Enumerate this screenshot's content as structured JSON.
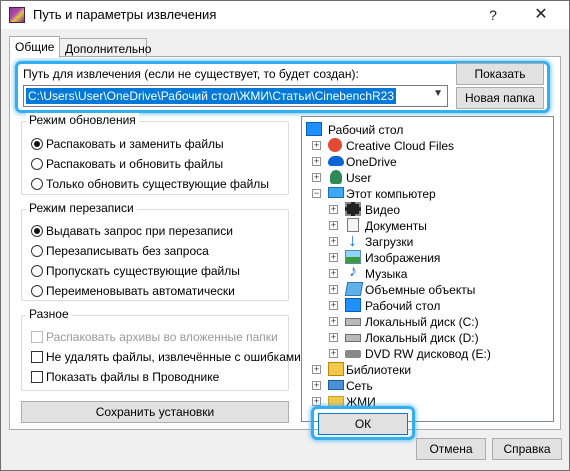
{
  "window": {
    "title": "Путь и параметры извлечения",
    "help": "?",
    "close": "✕"
  },
  "tabs": [
    "Общие",
    "Дополнительно"
  ],
  "path": {
    "label": "Путь для извлечения (если не существует, то будет создан):",
    "value": "C:\\Users\\User\\OneDrive\\Рабочий стол\\ЖМИ\\Статьи\\CinebenchR23",
    "show_button": "Показать",
    "new_folder_button": "Новая папка"
  },
  "update_mode": {
    "title": "Режим обновления",
    "options": [
      {
        "label": "Распаковать и заменить файлы",
        "selected": true
      },
      {
        "label": "Распаковать и обновить файлы",
        "selected": false
      },
      {
        "label": "Только обновить существующие файлы",
        "selected": false
      }
    ]
  },
  "overwrite_mode": {
    "title": "Режим перезаписи",
    "options": [
      {
        "label": "Выдавать запрос при перезаписи",
        "selected": true
      },
      {
        "label": "Перезаписывать без запроса",
        "selected": false
      },
      {
        "label": "Пропускать существующие файлы",
        "selected": false
      },
      {
        "label": "Переименовывать автоматически",
        "selected": false
      }
    ]
  },
  "misc": {
    "title": "Разное",
    "options": [
      {
        "label": "Распаковать архивы во вложенные папки",
        "checked": false,
        "disabled": true
      },
      {
        "label": "Не удалять файлы, извлечённые с ошибками",
        "checked": false,
        "disabled": false
      },
      {
        "label": "Показать файлы в Проводнике",
        "checked": false,
        "disabled": false
      }
    ]
  },
  "save_settings": "Сохранить установки",
  "tree": {
    "root": "Рабочий стол",
    "items": [
      "Creative Cloud Files",
      "OneDrive",
      "User",
      "Этот компьютер",
      "Видео",
      "Документы",
      "Загрузки",
      "Изображения",
      "Музыка",
      "Объемные объекты",
      "Рабочий стол",
      "Локальный диск (C:)",
      "Локальный диск (D:)",
      "DVD RW дисковод (E:)",
      "Библиотеки",
      "Сеть",
      "ЖМИ"
    ]
  },
  "footer": {
    "ok": "ОК",
    "cancel": "Отмена",
    "help": "Справка"
  },
  "colors": {
    "highlight": "#33aef0",
    "selection": "#0078d7"
  }
}
